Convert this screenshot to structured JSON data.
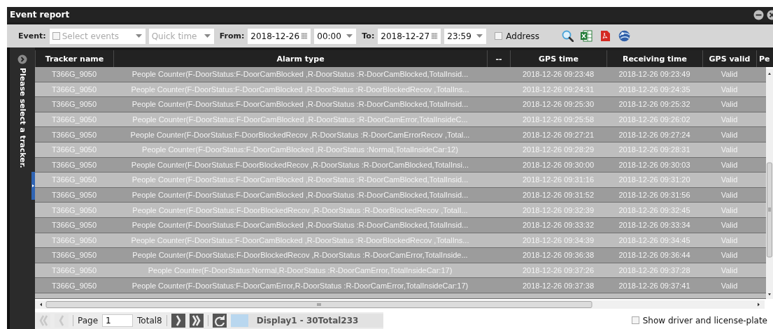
{
  "window": {
    "title": "Event report"
  },
  "toolbar": {
    "event_label": "Event:",
    "event_select": {
      "placeholder": "Select events",
      "checked": false
    },
    "quick_time": {
      "placeholder": "Quick time"
    },
    "from_label": "From:",
    "from_date": "2018-12-26",
    "from_time": "00:00",
    "to_label": "To:",
    "to_date": "2018-12-27",
    "to_time": "23:59",
    "address": {
      "label": "Address",
      "checked": false
    }
  },
  "sidebar": {
    "text": "Please select a tracker."
  },
  "table": {
    "columns": [
      "Tracker name",
      "Alarm type",
      "--",
      "GPS time",
      "Receiving time",
      "GPS valid",
      "Pe"
    ],
    "rows": [
      {
        "tracker_name": "T366G_9050",
        "alarm_type": "People Counter(F-DoorStatus:F-DoorCamBlocked ,R-DoorStatus :R-DoorCamBlocked,TotalInsid...",
        "gps_time": "2018-12-26 09:23:48",
        "receiving_time": "2018-12-26 09:23:49",
        "gps_valid": "Valid"
      },
      {
        "tracker_name": "T366G_9050",
        "alarm_type": "People Counter(F-DoorStatus:F-DoorCamBlocked ,R-DoorStatus :R-DoorBlockedRecov ,TotalIns...",
        "gps_time": "2018-12-26 09:24:31",
        "receiving_time": "2018-12-26 09:24:35",
        "gps_valid": "Valid"
      },
      {
        "tracker_name": "T366G_9050",
        "alarm_type": "People Counter(F-DoorStatus:F-DoorCamBlocked ,R-DoorStatus :R-DoorCamBlocked,TotalInsid...",
        "gps_time": "2018-12-26 09:25:30",
        "receiving_time": "2018-12-26 09:25:32",
        "gps_valid": "Valid"
      },
      {
        "tracker_name": "T366G_9050",
        "alarm_type": "People Counter(F-DoorStatus:F-DoorCamBlocked ,R-DoorStatus :R-DoorCamError,TotalInsideC...",
        "gps_time": "2018-12-26 09:25:58",
        "receiving_time": "2018-12-26 09:26:02",
        "gps_valid": "Valid"
      },
      {
        "tracker_name": "T366G_9050",
        "alarm_type": "People Counter(F-DoorStatus:F-DoorBlockedRecov ,R-DoorStatus :R-DoorCamErrorRecov ,Total...",
        "gps_time": "2018-12-26 09:27:21",
        "receiving_time": "2018-12-26 09:27:24",
        "gps_valid": "Valid"
      },
      {
        "tracker_name": "T366G_9050",
        "alarm_type": "People Counter(F-DoorStatus:F-DoorCamBlocked ,R-DoorStatus :Normal,TotalInsideCar:12)",
        "gps_time": "2018-12-26 09:28:29",
        "receiving_time": "2018-12-26 09:28:31",
        "gps_valid": "Valid"
      },
      {
        "tracker_name": "T366G_9050",
        "alarm_type": "People Counter(F-DoorStatus:F-DoorBlockedRecov ,R-DoorStatus :R-DoorCamBlocked,TotalInsi...",
        "gps_time": "2018-12-26 09:30:00",
        "receiving_time": "2018-12-26 09:30:03",
        "gps_valid": "Valid"
      },
      {
        "tracker_name": "T366G_9050",
        "alarm_type": "People Counter(F-DoorStatus:F-DoorCamBlocked ,R-DoorStatus :R-DoorCamBlocked,TotalInsid...",
        "gps_time": "2018-12-26 09:31:16",
        "receiving_time": "2018-12-26 09:31:20",
        "gps_valid": "Valid"
      },
      {
        "tracker_name": "T366G_9050",
        "alarm_type": "People Counter(F-DoorStatus:F-DoorCamBlocked ,R-DoorStatus :R-DoorCamBlocked,TotalInsid...",
        "gps_time": "2018-12-26 09:31:52",
        "receiving_time": "2018-12-26 09:31:56",
        "gps_valid": "Valid"
      },
      {
        "tracker_name": "T366G_9050",
        "alarm_type": "People Counter(F-DoorStatus:F-DoorBlockedRecov ,R-DoorStatus :R-DoorBlockedRecov ,TotalI...",
        "gps_time": "2018-12-26 09:32:39",
        "receiving_time": "2018-12-26 09:32:45",
        "gps_valid": "Valid"
      },
      {
        "tracker_name": "T366G_9050",
        "alarm_type": "People Counter(F-DoorStatus:F-DoorCamBlocked ,R-DoorStatus :R-DoorCamBlocked,TotalInsid...",
        "gps_time": "2018-12-26 09:33:32",
        "receiving_time": "2018-12-26 09:33:34",
        "gps_valid": "Valid"
      },
      {
        "tracker_name": "T366G_9050",
        "alarm_type": "People Counter(F-DoorStatus:F-DoorCamBlocked ,R-DoorStatus :R-DoorBlockedRecov ,TotalIns...",
        "gps_time": "2018-12-26 09:34:39",
        "receiving_time": "2018-12-26 09:34:45",
        "gps_valid": "Valid"
      },
      {
        "tracker_name": "T366G_9050",
        "alarm_type": "People Counter(F-DoorStatus:F-DoorBlockedRecov ,R-DoorStatus :R-DoorCamError,TotalInside...",
        "gps_time": "2018-12-26 09:36:38",
        "receiving_time": "2018-12-26 09:36:44",
        "gps_valid": "Valid"
      },
      {
        "tracker_name": "T366G_9050",
        "alarm_type": "People Counter(F-DoorStatus:Normal,R-DoorStatus :R-DoorCamError,TotalInsideCar:17)",
        "gps_time": "2018-12-26 09:37:26",
        "receiving_time": "2018-12-26 09:37:28",
        "gps_valid": "Valid"
      },
      {
        "tracker_name": "T366G_9050",
        "alarm_type": "People Counter(F-DoorStatus:F-DoorCamError,R-DoorStatus :R-DoorCamError,TotalInsideCar:17)",
        "gps_time": "2018-12-26 09:37:38",
        "receiving_time": "2018-12-26 09:37:41",
        "gps_valid": "Valid"
      }
    ]
  },
  "pager": {
    "nav_buttons": [
      {
        "kind": "first",
        "disabled": true
      },
      {
        "kind": "prev",
        "disabled": true
      }
    ],
    "page_label": "Page",
    "page_value": "1",
    "total": "Total8",
    "nav_buttons_after": [
      {
        "kind": "next",
        "disabled": false
      },
      {
        "kind": "last",
        "disabled": false
      }
    ],
    "display": "Display1 - 30Total233",
    "show_driver": {
      "label": "Show driver and license-plate",
      "checked": false
    }
  }
}
